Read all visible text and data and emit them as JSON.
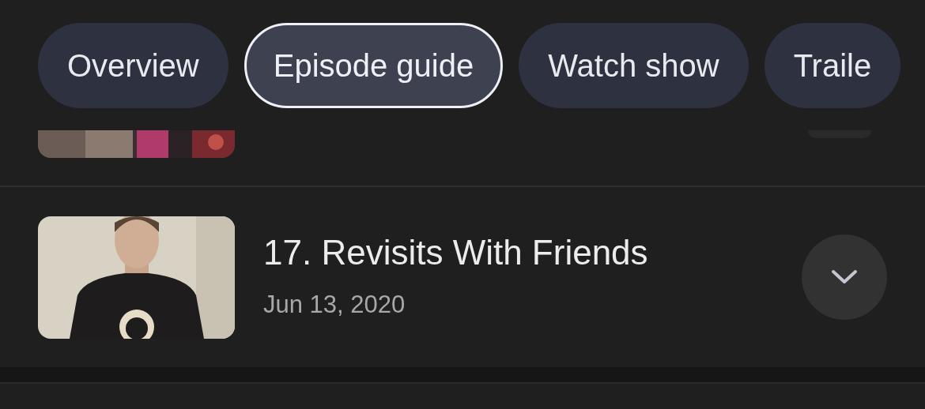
{
  "tabs": [
    {
      "label": "Overview",
      "selected": false
    },
    {
      "label": "Episode guide",
      "selected": true
    },
    {
      "label": "Watch show",
      "selected": false
    },
    {
      "label": "Traile",
      "selected": false
    }
  ],
  "episodes": [
    {
      "kind": "partial",
      "expanded": false
    },
    {
      "kind": "full",
      "title": "17. Revisits With Friends",
      "date": "Jun 13, 2020",
      "expanded": false
    }
  ]
}
